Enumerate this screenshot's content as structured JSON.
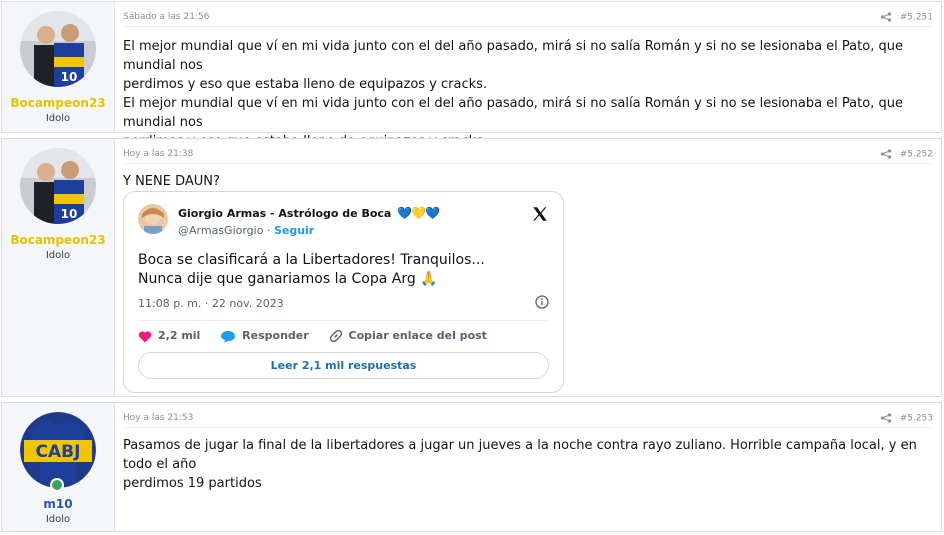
{
  "posts": [
    {
      "username": "Bocampeon23",
      "user_title": "Idolo",
      "date": "Sábado a las 21:56",
      "post_number": "#5.251",
      "body_lines": [
        "El mejor mundial que ví en mi vida junto con el del año pasado, mirá si no salía Román y si no se lesionaba el Pato, que mundial nos",
        "perdimos y eso que estaba lleno de equipazos y cracks.",
        "El mejor mundial que ví en mi vida junto con el del año pasado, mirá si no salía Román y si no se lesionaba el Pato, que mundial nos",
        "perdimos y eso que estaba lleno de equipazos y cracks."
      ]
    },
    {
      "username": "Bocampeon23",
      "user_title": "Idolo",
      "date": "Hoy a las 21:38",
      "post_number": "#5.252",
      "body_lines": [
        "Y NENE DAUN?"
      ],
      "tweet": {
        "author_name": "Giorgio Armas - Astrólogo de Boca",
        "author_emoji": "💙💛💙",
        "handle": "@ArmasGiorgio",
        "follow_label": "Seguir",
        "text_lines": [
          "Boca se clasificará a la Libertadores! Tranquilos...",
          "Nunca dije que ganariamos la Copa Arg 🙏"
        ],
        "timestamp": "11:08 p. m. · 22 nov. 2023",
        "likes": "2,2 mil",
        "reply_label": "Responder",
        "copy_label": "Copiar enlace del post",
        "read_replies_label": "Leer 2,1 mil respuestas"
      }
    },
    {
      "username": "m10",
      "user_title": "Idolo",
      "date": "Hoy a las 21:53",
      "post_number": "#5.253",
      "avatar_text": "CABJ",
      "body_lines": [
        "Pasamos de jugar la final de la libertadores a jugar un jueves a la noche contra rayo zuliano. Horrible campaña local, y en todo el año",
        "perdimos 19 partidos"
      ]
    }
  ],
  "colors": {
    "username_gold": "#e6c200",
    "username_blue": "#2456a6",
    "like_pink": "#f91880",
    "reply_blue": "#1d9bf0"
  },
  "icons": [
    "share-icon",
    "x-logo-icon",
    "info-icon",
    "heart-icon",
    "reply-bubble-icon",
    "link-icon"
  ]
}
